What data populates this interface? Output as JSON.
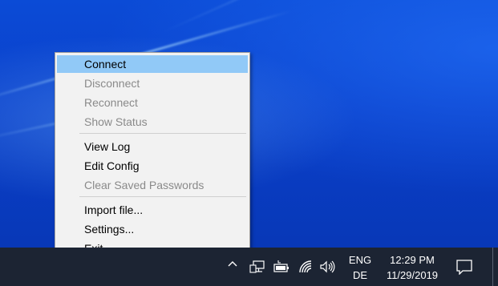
{
  "menu": {
    "items": [
      {
        "label": "Connect",
        "enabled": true,
        "highlighted": true
      },
      {
        "label": "Disconnect",
        "enabled": false
      },
      {
        "label": "Reconnect",
        "enabled": false
      },
      {
        "label": "Show Status",
        "enabled": false
      },
      {
        "label": "View Log",
        "enabled": true
      },
      {
        "label": "Edit Config",
        "enabled": true
      },
      {
        "label": "Clear Saved Passwords",
        "enabled": false
      },
      {
        "label": "Import file...",
        "enabled": true
      },
      {
        "label": "Settings...",
        "enabled": true
      },
      {
        "label": "Exit",
        "enabled": true
      }
    ]
  },
  "taskbar": {
    "tray_icons": [
      "chevron-up-icon",
      "network-wired-icon",
      "battery-charging-icon",
      "wifi-icon",
      "volume-icon"
    ],
    "language": {
      "line1": "ENG",
      "line2": "DE"
    },
    "clock": {
      "time": "12:29 PM",
      "date": "11/29/2019"
    },
    "notifications_icon": "action-center-icon"
  },
  "colors": {
    "desktop": "#0a3fca",
    "taskbar": "#1c2433",
    "menu_background": "#f2f2f2",
    "menu_highlight": "#91c9f7",
    "disabled_text": "#8a8a8a"
  }
}
